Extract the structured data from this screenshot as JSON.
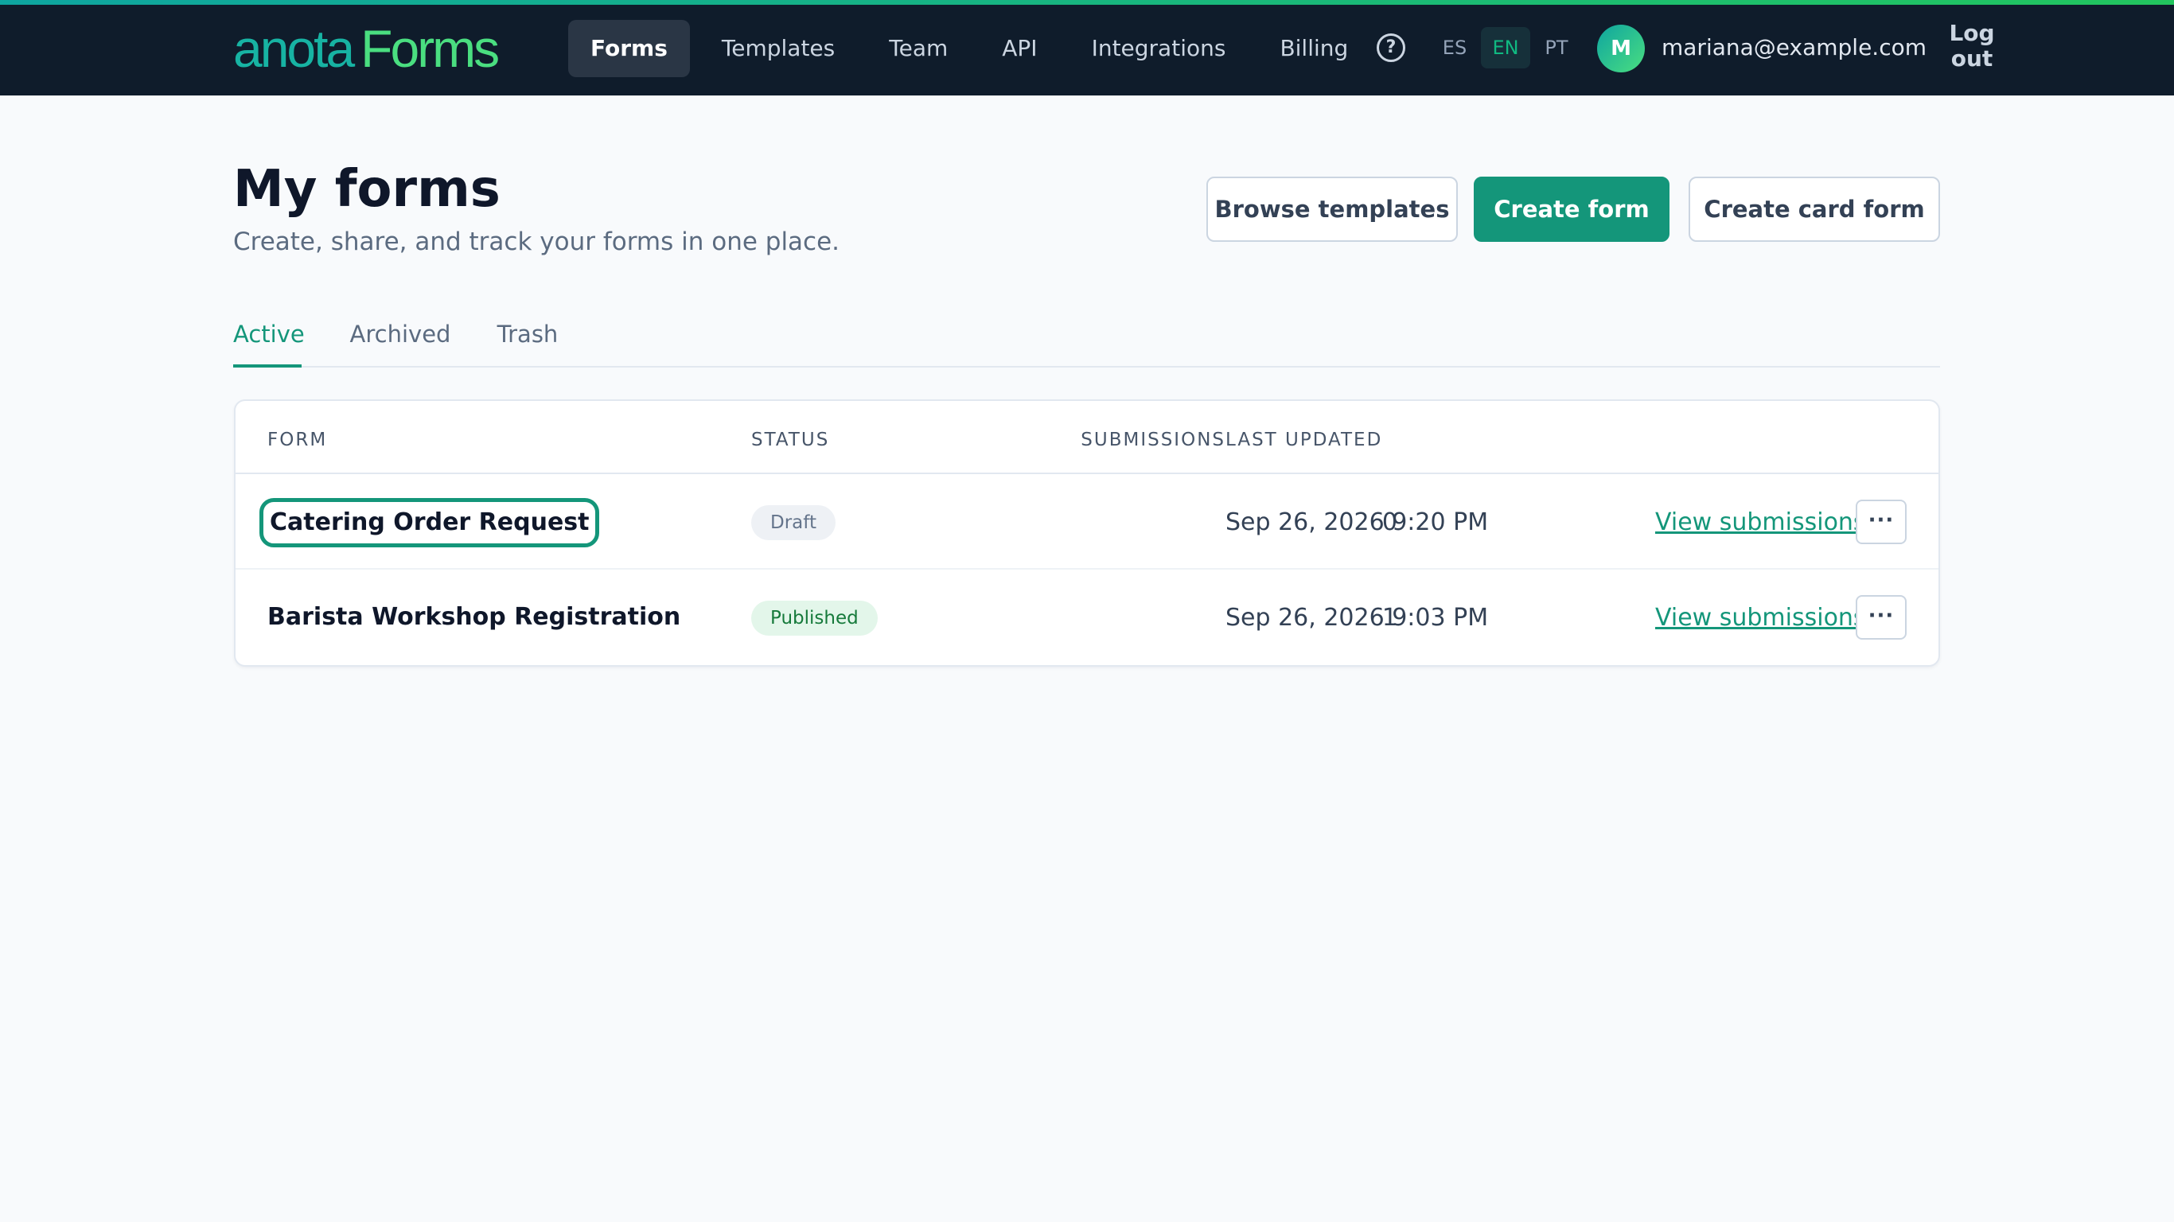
{
  "brand": {
    "logo_part1": "anota",
    "logo_part2": "Forms"
  },
  "nav": {
    "items": [
      {
        "label": "Forms",
        "active": true
      },
      {
        "label": "Templates"
      },
      {
        "label": "Team"
      },
      {
        "label": "API"
      },
      {
        "label": "Integrations"
      },
      {
        "label": "Billing"
      }
    ],
    "help_icon": "?",
    "languages": [
      {
        "label": "ES"
      },
      {
        "label": "EN",
        "active": true
      },
      {
        "label": "PT"
      }
    ],
    "avatar_initial": "M",
    "user_email": "mariana@example.com",
    "logout_line1": "Log",
    "logout_line2": "out"
  },
  "header": {
    "title": "My forms",
    "subtitle": "Create, share, and track your forms in one place.",
    "browse_templates": "Browse templates",
    "create_form": "Create form",
    "create_card_form": "Create card form"
  },
  "tabs": [
    {
      "label": "Active",
      "active": true
    },
    {
      "label": "Archived"
    },
    {
      "label": "Trash"
    }
  ],
  "table": {
    "columns": [
      "FORM",
      "STATUS",
      "SUBMISSIONS",
      "LAST UPDATED"
    ],
    "rows": [
      {
        "name": "Catering Order Request",
        "status": "Draft",
        "submissions": "0",
        "last_updated": "Sep 26, 2026 9:20 PM",
        "action": "View submissions",
        "more": "···"
      },
      {
        "name": "Barista Workshop Registration",
        "status": "Published",
        "submissions": "1",
        "last_updated": "Sep 26, 2026 9:03 PM",
        "action": "View submissions",
        "more": "···"
      }
    ]
  },
  "colors": {
    "topbar": "#0f1c2b",
    "accent": "#14967a",
    "published_badge": "#e3f6ea",
    "draft_badge": "#eef1f5"
  }
}
